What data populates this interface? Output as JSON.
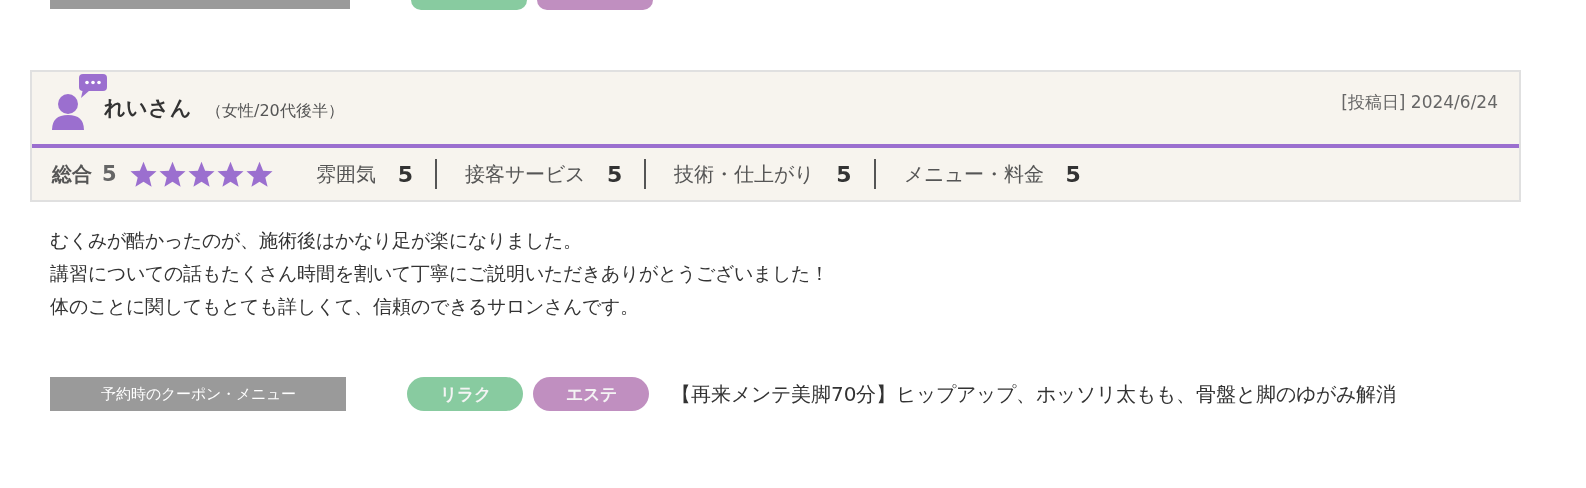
{
  "review": {
    "reviewer": {
      "name": "れいさん",
      "profile": "（女性/20代後半）"
    },
    "posted": "[投稿日] 2024/6/24",
    "overall": {
      "label": "総合",
      "score": "5",
      "stars": 5
    },
    "ratings": [
      {
        "label": "雰囲気",
        "score": "5"
      },
      {
        "label": "接客サービス",
        "score": "5"
      },
      {
        "label": "技術・仕上がり",
        "score": "5"
      },
      {
        "label": "メニュー・料金",
        "score": "5"
      }
    ],
    "body": [
      "むくみが酷かったのが、施術後はかなり足が楽になりました。",
      "講習についての話もたくさん時間を割いて丁寧にご説明いただきありがとうございました！",
      "体のことに関してもとても詳しくて、信頼のできるサロンさんです。"
    ],
    "coupon": {
      "heading": "予約時のクーポン・メニュー",
      "tags": [
        {
          "label": "リラク",
          "color": "#88cba0"
        },
        {
          "label": "エステ",
          "color": "#c08fc0"
        }
      ],
      "menu": "【再来メンテ美脚70分】ヒップアップ、ホッソリ太もも、骨盤と脚のゆがみ解消"
    }
  }
}
